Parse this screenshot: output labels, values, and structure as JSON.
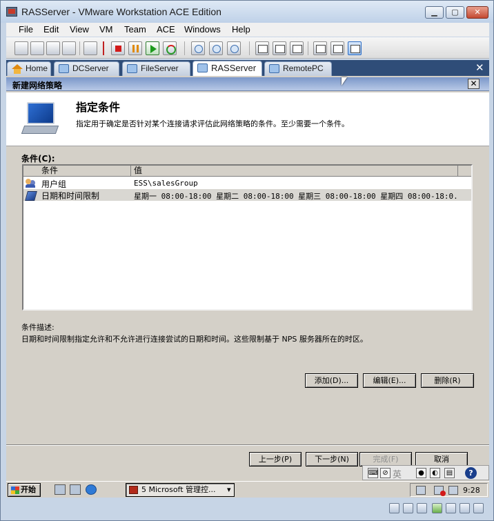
{
  "window": {
    "title": "RASServer - VMware Workstation ACE Edition",
    "close_glyph": "✕"
  },
  "menu": [
    "File",
    "Edit",
    "View",
    "VM",
    "Team",
    "ACE",
    "Windows",
    "Help"
  ],
  "tabs": [
    {
      "label": "Home",
      "active": false
    },
    {
      "label": "DCServer",
      "active": false
    },
    {
      "label": "FileServer",
      "active": false
    },
    {
      "label": "RASServer",
      "active": true
    },
    {
      "label": "RemotePC",
      "active": false
    }
  ],
  "tabbar": {
    "close_glyph": "✕"
  },
  "dialog": {
    "title": "新建网络策略",
    "close_glyph": "✕",
    "header_title": "指定条件",
    "header_desc": "指定用于确定是否针对某个连接请求评估此网络策略的条件。至少需要一个条件。",
    "conditions_label": "条件(C):",
    "columns": [
      "条件",
      "值"
    ],
    "rows": [
      {
        "name": "用户组",
        "value": "ESS\\salesGroup",
        "icon": "users-icon"
      },
      {
        "name": "日期和时间限制",
        "value": "星期一 08:00-18:00 星期二 08:00-18:00 星期三 08:00-18:00 星期四 08:00-18:0...",
        "icon": "clock-icon"
      }
    ],
    "description_label": "条件描述:",
    "description_text": "日期和时间限制指定允许和不允许进行连接尝试的日期和时间。这些限制基于 NPS 服务器所在的时区。",
    "add_button": "添加(D)...",
    "edit_button": "编辑(E)...",
    "delete_button": "删除(R)",
    "prev_button": "上一步(P)",
    "next_button": "下一步(N)",
    "finish_button": "完成(F)",
    "cancel_button": "取消"
  },
  "langbar": {
    "lang_text": "英",
    "help_glyph": "?"
  },
  "taskbar": {
    "start_label": "开始",
    "task_label": "5 Microsoft 管理控...",
    "task_arrow": "▾",
    "clock": "9:28"
  },
  "colors": {
    "accent": "#2f4d78",
    "dialog_bg": "#d4d0c8",
    "selected_row": "#d9d7d2"
  }
}
